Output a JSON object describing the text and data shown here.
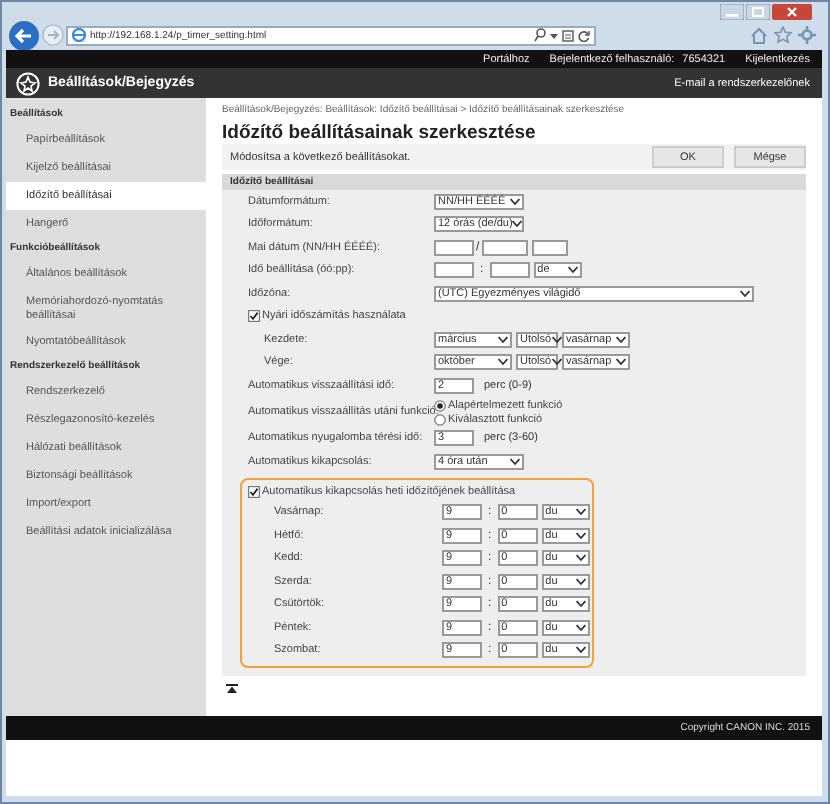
{
  "browser": {
    "url": "http://192.168.1.24/p_timer_setting.html"
  },
  "top_bar": {
    "portal": "Portálhoz",
    "login_label": "Bejelentkező felhasználó:",
    "user": "7654321",
    "logout": "Kijelentkezés"
  },
  "header": {
    "title": "Beállítások/Bejegyzés",
    "email_link": "E-mail a rendszerkezelőnek"
  },
  "sidebar": {
    "sections": [
      {
        "heading": "Beállítások",
        "items": [
          {
            "label": "Papírbeállítások",
            "selected": false
          },
          {
            "label": "Kijelző beállításai",
            "selected": false
          },
          {
            "label": "Időzítő beállításai",
            "selected": true
          },
          {
            "label": "Hangerő",
            "selected": false
          }
        ]
      },
      {
        "heading": "Funkcióbeállítások",
        "items": [
          {
            "label": "Általános beállítások",
            "selected": false
          },
          {
            "label": "Memóriahordozó-nyomtatás beállításai",
            "selected": false
          },
          {
            "label": "Nyomtatóbeállítások",
            "selected": false
          }
        ]
      },
      {
        "heading": "Rendszerkezelő beállítások",
        "items": [
          {
            "label": "Rendszerkezelő",
            "selected": false
          },
          {
            "label": "Részlegazonosító-kezelés",
            "selected": false
          },
          {
            "label": "Hálózati beállítások",
            "selected": false
          },
          {
            "label": "Biztonsági beállítások",
            "selected": false
          },
          {
            "label": "Import/export",
            "selected": false
          },
          {
            "label": "Beállítási adatok inicializálása",
            "selected": false
          }
        ]
      }
    ]
  },
  "main": {
    "breadcrumb": "Beállítások/Bejegyzés: Beállítások: Időzítő beállításai > Időzítő beállításainak szerkesztése",
    "title": "Időzítő beállításainak szerkesztése",
    "instruction": "Módosítsa a következő beállításokat.",
    "buttons": [
      "OK",
      "Mégse"
    ],
    "section_title": "Időzítő beállításai",
    "rows": [
      {
        "kind": "select",
        "label": "Dátumformátum:",
        "value": "NN/HH ÉÉÉÉ"
      },
      {
        "kind": "select",
        "label": "Időformátum:",
        "value": "12 órás (de/du)"
      },
      {
        "kind": "date",
        "label": "Mai dátum (NN/HH ÉÉÉÉ):",
        "separator": "/"
      },
      {
        "kind": "time",
        "label": "Idő beállítása (óó:pp):",
        "separator": ":",
        "ampm": "de"
      },
      {
        "kind": "wideselect",
        "label": "Időzóna:",
        "value": "(UTC) Egyezményes világidő"
      },
      {
        "kind": "checkbox",
        "label": "Nyári időszámítás használata",
        "checked": true
      },
      {
        "kind": "triple",
        "label": "Kezdete:",
        "values": [
          "március",
          "Utolsó",
          "vasárnap"
        ]
      },
      {
        "kind": "triple",
        "label": "Vége:",
        "values": [
          "október",
          "Utolsó",
          "vasárnap"
        ]
      },
      {
        "kind": "number",
        "label": "Automatikus visszaállítási idő:",
        "value": "2",
        "suffix": "perc (0-9)"
      },
      {
        "kind": "radio",
        "label": "Automatikus visszaállítás utáni funkció:",
        "options": [
          {
            "label": "Alapértelmezett funkció",
            "selected": true
          },
          {
            "label": "Kiválasztott funkció",
            "selected": false
          }
        ]
      },
      {
        "kind": "number",
        "label": "Automatikus nyugalomba térési idő:",
        "value": "3",
        "suffix": "perc (3-60)"
      },
      {
        "kind": "select",
        "label": "Automatikus kikapcsolás:",
        "value": "4 óra után"
      }
    ],
    "weekly": {
      "label": "Automatikus kikapcsolás heti időzítőjének beállítása",
      "checked": true,
      "separator": ":",
      "days": [
        {
          "label": "Vasárnap:",
          "hour": "9",
          "minute": "0",
          "ampm": "du"
        },
        {
          "label": "Hétfő:",
          "hour": "9",
          "minute": "0",
          "ampm": "du"
        },
        {
          "label": "Kedd:",
          "hour": "9",
          "minute": "0",
          "ampm": "du"
        },
        {
          "label": "Szerda:",
          "hour": "9",
          "minute": "0",
          "ampm": "du"
        },
        {
          "label": "Csütörtök:",
          "hour": "9",
          "minute": "0",
          "ampm": "du"
        },
        {
          "label": "Péntek:",
          "hour": "9",
          "minute": "0",
          "ampm": "du"
        },
        {
          "label": "Szombat:",
          "hour": "9",
          "minute": "0",
          "ampm": "du"
        }
      ]
    }
  },
  "footer": {
    "copyright": "Copyright CANON INC. 2015"
  }
}
